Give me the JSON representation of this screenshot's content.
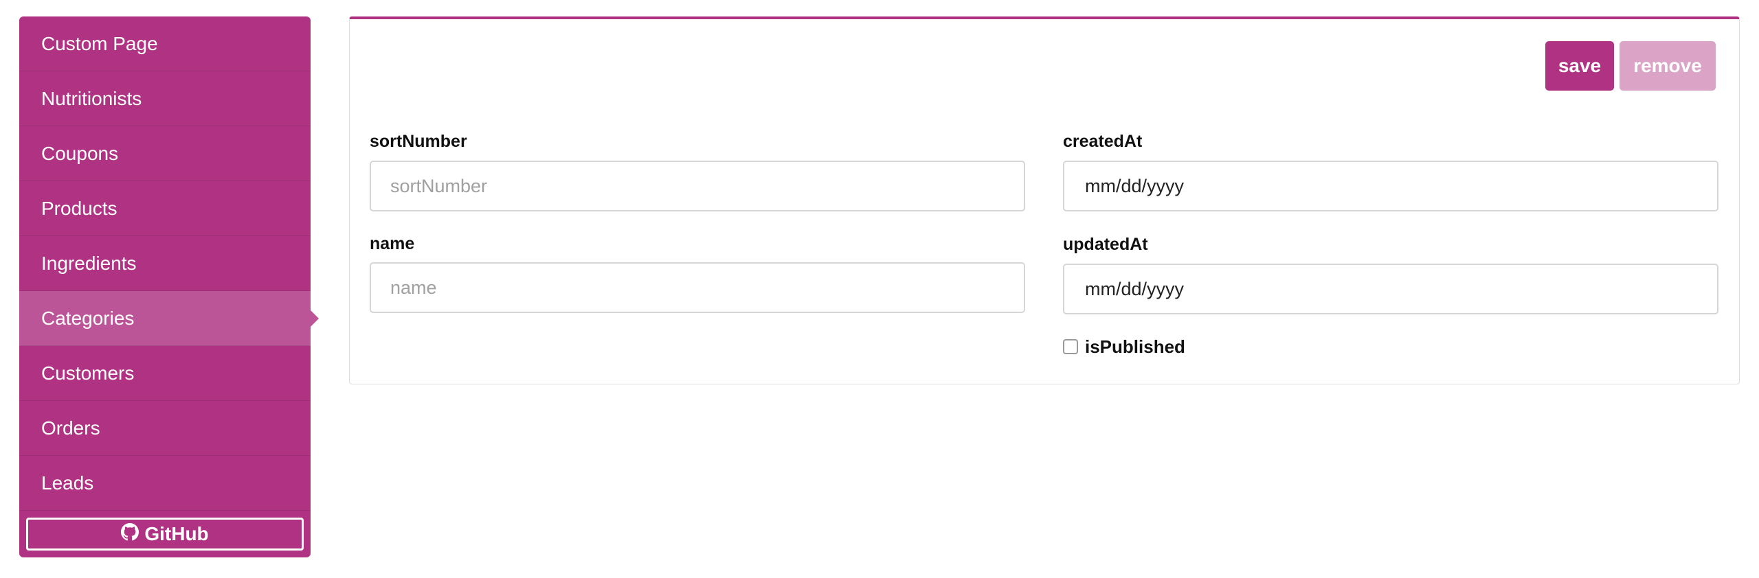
{
  "sidebar": {
    "items": [
      {
        "label": "Custom Page",
        "active": false
      },
      {
        "label": "Nutritionists",
        "active": false
      },
      {
        "label": "Coupons",
        "active": false
      },
      {
        "label": "Products",
        "active": false
      },
      {
        "label": "Ingredients",
        "active": false
      },
      {
        "label": "Categories",
        "active": true
      },
      {
        "label": "Customers",
        "active": false
      },
      {
        "label": "Orders",
        "active": false
      },
      {
        "label": "Leads",
        "active": false
      }
    ],
    "github_label": "GitHub",
    "github_icon": "github-icon"
  },
  "toolbar": {
    "save_label": "save",
    "remove_label": "remove"
  },
  "form": {
    "sortNumber": {
      "label": "sortNumber",
      "placeholder": "sortNumber",
      "value": ""
    },
    "name": {
      "label": "name",
      "placeholder": "name",
      "value": ""
    },
    "createdAt": {
      "label": "createdAt",
      "value": "mm/dd/yyyy"
    },
    "updatedAt": {
      "label": "updatedAt",
      "value": "mm/dd/yyyy"
    },
    "isPublished": {
      "label": "isPublished",
      "checked": false
    }
  },
  "colors": {
    "brand": "#b03383",
    "active_item": "#bc5598",
    "disabled_button": "#dba4c7",
    "border": "#d6d6d6"
  }
}
